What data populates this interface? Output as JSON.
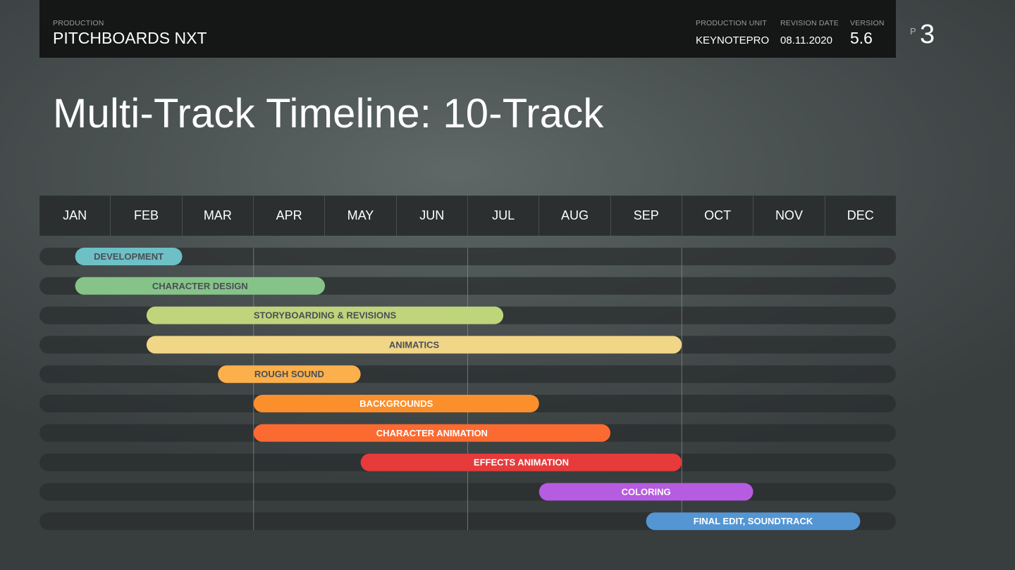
{
  "header": {
    "production_label": "PRODUCTION",
    "production_value": "PITCHBOARDS NXT",
    "unit_label": "PRODUCTION UNIT",
    "unit_value": "KEYNOTEPRO",
    "revision_label": "REVISION DATE",
    "revision_value": "08.11.2020",
    "version_label": "VERSION",
    "version_value": "5.6",
    "page_prefix": "P",
    "page_number": "3"
  },
  "chart_data": {
    "type": "gantt",
    "title": "Multi-Track Timeline: 10-Track",
    "categories": [
      "JAN",
      "FEB",
      "MAR",
      "APR",
      "MAY",
      "JUN",
      "JUL",
      "AUG",
      "SEP",
      "OCT",
      "NOV",
      "DEC"
    ],
    "x_unit": "months from start of JAN",
    "xlim": [
      0,
      12
    ],
    "quarter_gridlines_at": [
      3,
      6,
      9
    ],
    "tracks": [
      {
        "name": "DEVELOPMENT",
        "start": 0.5,
        "end": 2.0,
        "color": "#6cc0c6",
        "text_color": "#4a4f55"
      },
      {
        "name": "CHARACTER DESIGN",
        "start": 0.5,
        "end": 4.0,
        "color": "#86c389",
        "text_color": "#4a4f55"
      },
      {
        "name": "STORYBOARDING & REVISIONS",
        "start": 1.5,
        "end": 6.5,
        "color": "#bfd57c",
        "text_color": "#4a4f55"
      },
      {
        "name": "ANIMATICS",
        "start": 1.5,
        "end": 9.0,
        "color": "#f1d687",
        "text_color": "#4a4f55"
      },
      {
        "name": "ROUGH SOUND",
        "start": 2.5,
        "end": 4.5,
        "color": "#fbb04c",
        "text_color": "#4a4f55"
      },
      {
        "name": "BACKGROUNDS",
        "start": 3.0,
        "end": 7.0,
        "color": "#fa8f2c",
        "text_color": "#ffffff"
      },
      {
        "name": "CHARACTER ANIMATION",
        "start": 3.0,
        "end": 8.0,
        "color": "#fb6a30",
        "text_color": "#ffffff"
      },
      {
        "name": "EFFECTS ANIMATION",
        "start": 4.5,
        "end": 9.0,
        "color": "#e63a3b",
        "text_color": "#ffffff"
      },
      {
        "name": "COLORING",
        "start": 7.0,
        "end": 10.0,
        "color": "#b65ce0",
        "text_color": "#ffffff"
      },
      {
        "name": "FINAL EDIT, SOUNDTRACK",
        "start": 8.5,
        "end": 11.5,
        "color": "#5496d4",
        "text_color": "#ffffff"
      }
    ]
  }
}
